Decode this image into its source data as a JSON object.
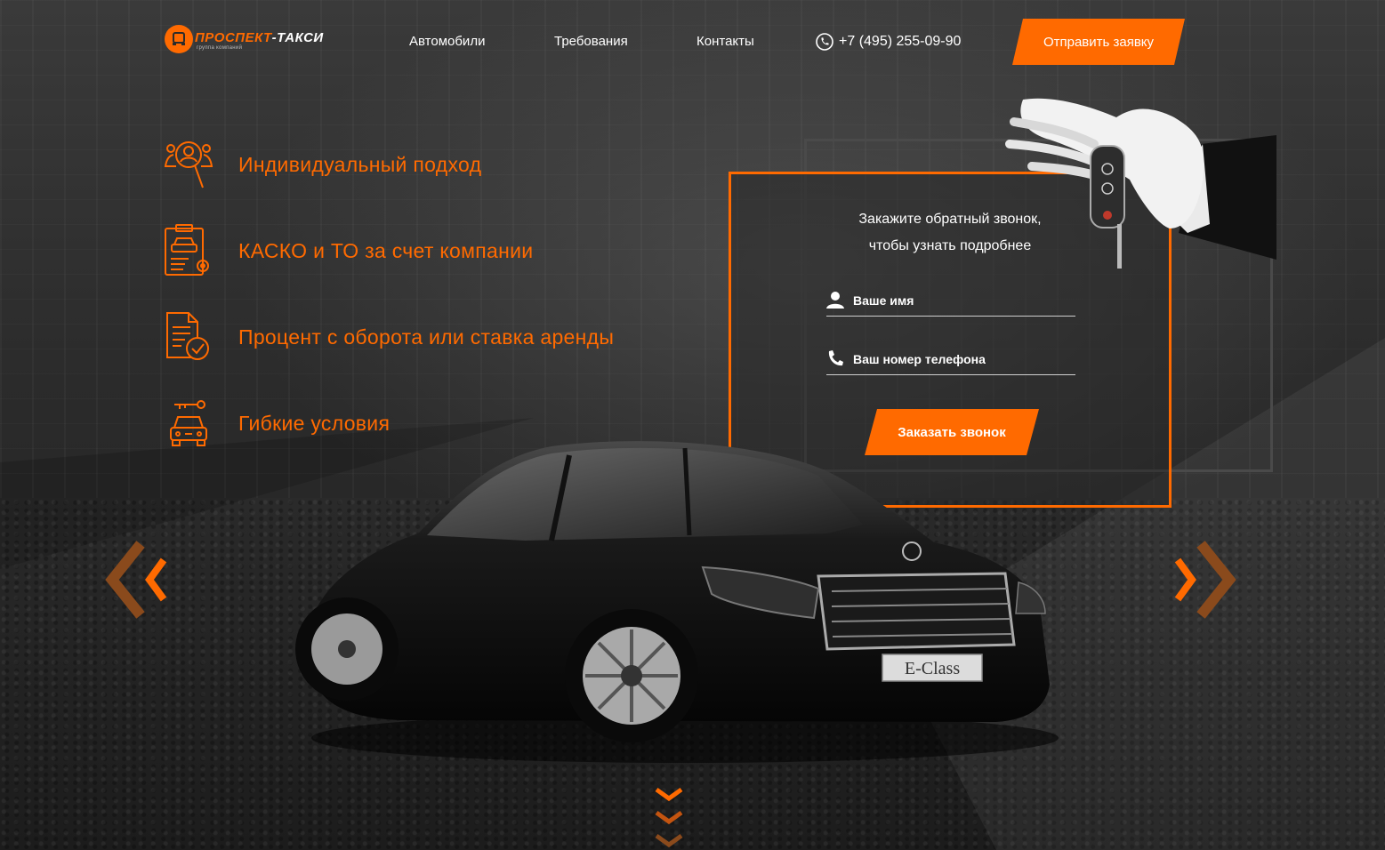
{
  "brand": {
    "name_part1": "ПРОСПЕКТ",
    "name_part2": "-ТАКСИ",
    "subtitle": "группа компаний",
    "accent_color": "#ff6a00"
  },
  "nav": {
    "items": [
      "Автомобили",
      "Требования",
      "Контакты"
    ]
  },
  "contact": {
    "phone": "+7 (495) 255-09-90",
    "icon": "phone-icon"
  },
  "header_cta": {
    "label": "Отправить заявку"
  },
  "features": [
    {
      "label": "Индивидуальный подход",
      "icon": "person-search-icon"
    },
    {
      "label": "КАСКО и ТО за счет компании",
      "icon": "insurance-document-icon"
    },
    {
      "label": "Процент с оборота или ставка аренды",
      "icon": "document-check-icon"
    },
    {
      "label": "Гибкие условия",
      "icon": "car-key-icon"
    }
  ],
  "callback_form": {
    "title_line1": "Закажите обратный звонок,",
    "title_line2": "чтобы узнать подробнее",
    "name_placeholder": "Ваше имя",
    "phone_placeholder": "Ваш номер телефона",
    "submit_label": "Заказать звонок"
  },
  "car": {
    "plate_text": "E-Class"
  },
  "slider": {
    "prev_icon": "chevron-left-icon",
    "next_icon": "chevron-right-icon"
  },
  "scroll": {
    "icon": "chevrons-down-icon"
  }
}
